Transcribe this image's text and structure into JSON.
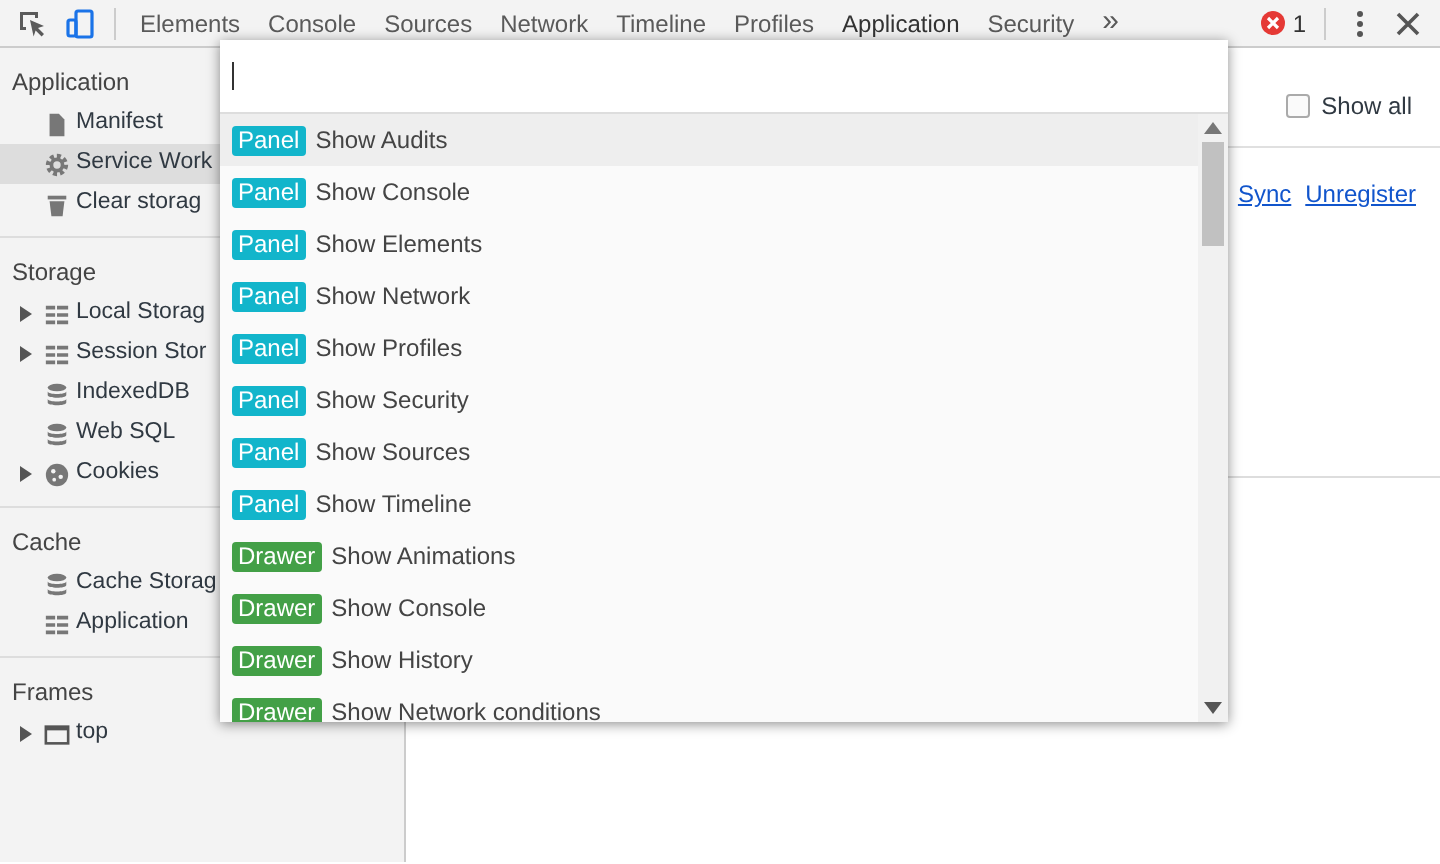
{
  "toolbar": {
    "tools": [
      {
        "kind": "inspect",
        "selected": false
      },
      {
        "kind": "device",
        "selected": true
      }
    ],
    "tabs": [
      {
        "label": "Elements",
        "selected": false
      },
      {
        "label": "Console",
        "selected": false
      },
      {
        "label": "Sources",
        "selected": false
      },
      {
        "label": "Network",
        "selected": false
      },
      {
        "label": "Timeline",
        "selected": false
      },
      {
        "label": "Profiles",
        "selected": false
      },
      {
        "label": "Application",
        "selected": true
      },
      {
        "label": "Security",
        "selected": false
      }
    ],
    "overflow": "»",
    "error_count": "1"
  },
  "sidebar": {
    "sections": [
      {
        "title": "Application",
        "items": [
          {
            "label": "Manifest",
            "kind": "file",
            "expandable": false,
            "selected": false
          },
          {
            "label": "Service Work",
            "kind": "gear",
            "expandable": false,
            "selected": true
          },
          {
            "label": "Clear storag",
            "kind": "trash",
            "expandable": false,
            "selected": false
          }
        ]
      },
      {
        "title": "Storage",
        "items": [
          {
            "label": "Local Storag",
            "kind": "grid",
            "expandable": true,
            "selected": false
          },
          {
            "label": "Session Stor",
            "kind": "grid",
            "expandable": true,
            "selected": false
          },
          {
            "label": "IndexedDB",
            "kind": "database",
            "expandable": false,
            "selected": false
          },
          {
            "label": "Web SQL",
            "kind": "database",
            "expandable": false,
            "selected": false
          },
          {
            "label": "Cookies",
            "kind": "cookie",
            "expandable": true,
            "selected": false
          }
        ]
      },
      {
        "title": "Cache",
        "items": [
          {
            "label": "Cache Storag",
            "kind": "database",
            "expandable": false,
            "selected": false
          },
          {
            "label": "Application",
            "kind": "grid",
            "expandable": false,
            "selected": false
          }
        ]
      },
      {
        "title": "Frames",
        "items": [
          {
            "label": "top",
            "kind": "frame",
            "expandable": true,
            "selected": false
          }
        ]
      }
    ]
  },
  "main": {
    "show_all": {
      "label": "Show all",
      "checked": false
    },
    "links": [
      "Sync",
      "Unregister"
    ]
  },
  "command_menu": {
    "items": [
      {
        "kind": "panel",
        "category": "Panel",
        "label": "Show Audits",
        "selected": true
      },
      {
        "kind": "panel",
        "category": "Panel",
        "label": "Show Console",
        "selected": false
      },
      {
        "kind": "panel",
        "category": "Panel",
        "label": "Show Elements",
        "selected": false
      },
      {
        "kind": "panel",
        "category": "Panel",
        "label": "Show Network",
        "selected": false
      },
      {
        "kind": "panel",
        "category": "Panel",
        "label": "Show Profiles",
        "selected": false
      },
      {
        "kind": "panel",
        "category": "Panel",
        "label": "Show Security",
        "selected": false
      },
      {
        "kind": "panel",
        "category": "Panel",
        "label": "Show Sources",
        "selected": false
      },
      {
        "kind": "panel",
        "category": "Panel",
        "label": "Show Timeline",
        "selected": false
      },
      {
        "kind": "drawer",
        "category": "Drawer",
        "label": "Show Animations",
        "selected": false
      },
      {
        "kind": "drawer",
        "category": "Drawer",
        "label": "Show Console",
        "selected": false
      },
      {
        "kind": "drawer",
        "category": "Drawer",
        "label": "Show History",
        "selected": false
      },
      {
        "kind": "drawer",
        "category": "Drawer",
        "label": "Show Network conditions",
        "selected": false
      }
    ]
  }
}
